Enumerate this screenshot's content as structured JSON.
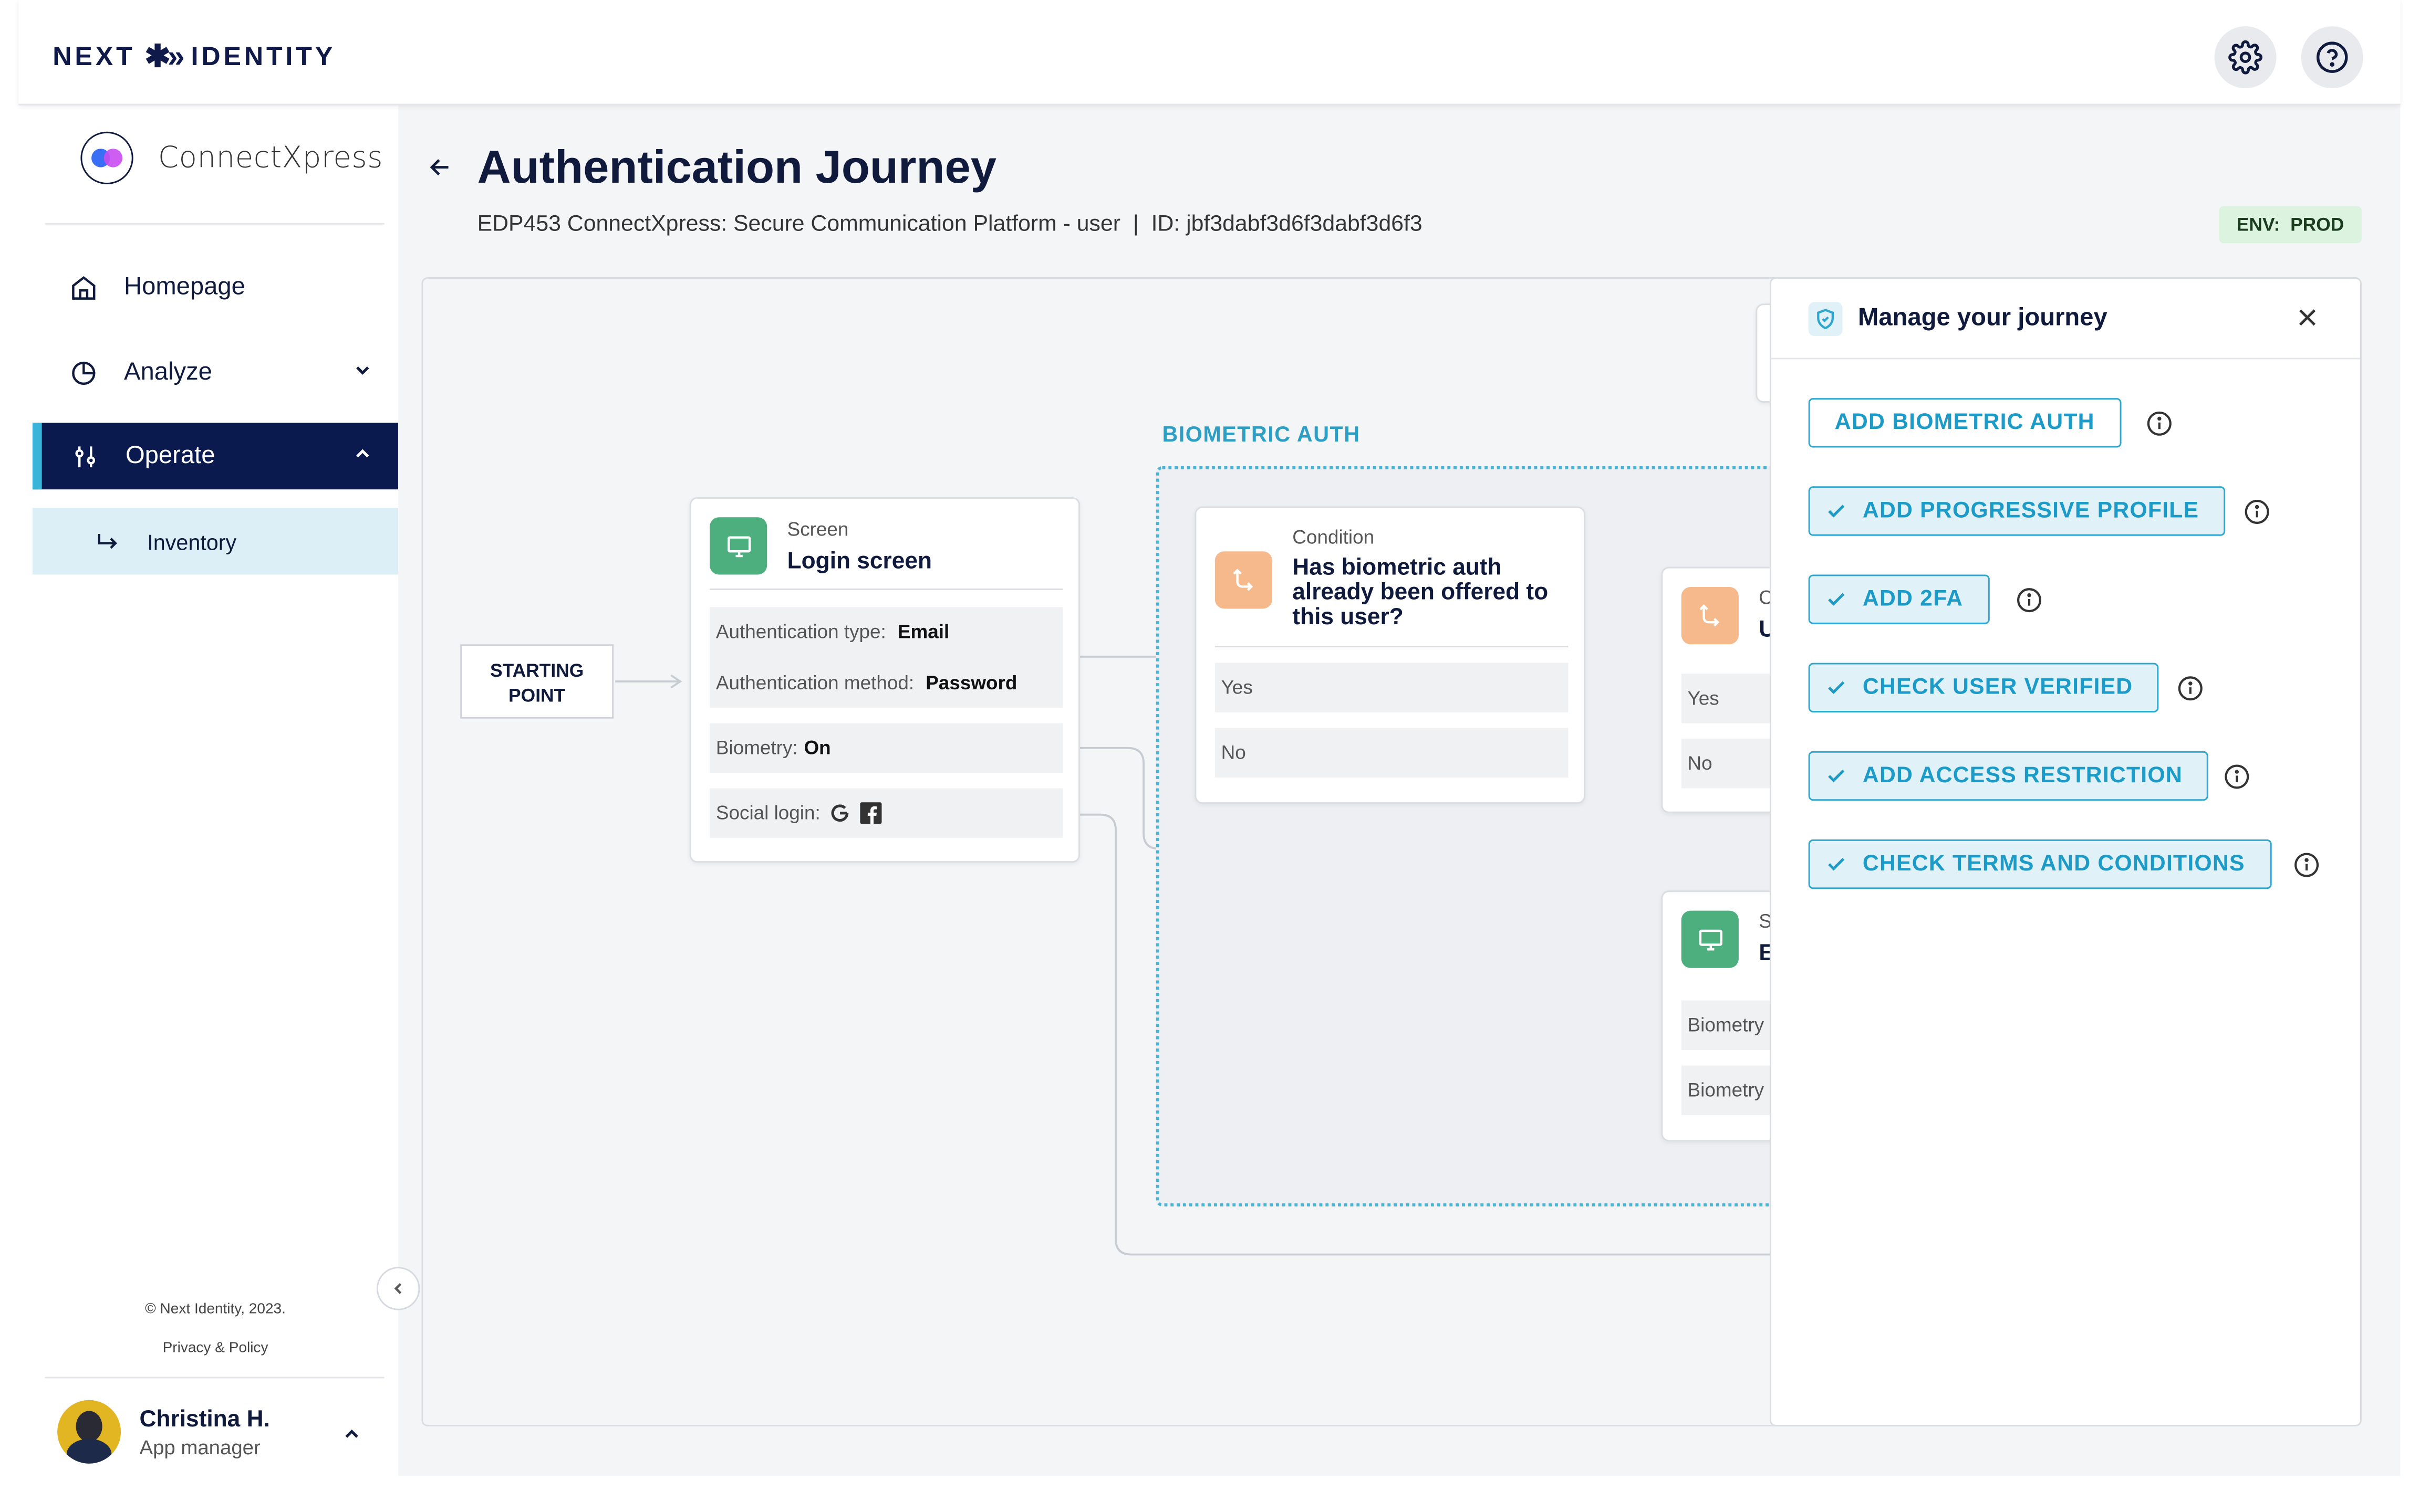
{
  "header": {
    "logo_left": "NEXT",
    "logo_mark": "✱»",
    "logo_right": "IDENTITY"
  },
  "sidebar": {
    "app_name": "ConnectXpress",
    "items": [
      {
        "label": "Homepage",
        "icon": "home-icon"
      },
      {
        "label": "Analyze",
        "icon": "pie-chart-icon"
      },
      {
        "label": "Operate",
        "icon": "sliders-icon"
      }
    ],
    "sub_item": {
      "label": "Inventory",
      "icon": "return-arrow-icon"
    },
    "copyright": "© Next Identity, 2023.",
    "privacy": "Privacy & Policy",
    "user": {
      "name": "Christina H.",
      "role": "App manager"
    }
  },
  "page": {
    "title": "Authentication Journey",
    "subtitle": "EDP453 ConnectXpress: Secure Communication Platform - user  |  ID: jbf3dabf3d6f3dabf3d6f3",
    "env_badge": "ENV:  PROD"
  },
  "canvas": {
    "start_label_1": "STARTING",
    "start_label_2": "POINT",
    "bio_zone_label": "BIOMETRIC AUTH",
    "login_card": {
      "kicker": "Screen",
      "title": "Login screen",
      "auth_type_label": "Authentication type:",
      "auth_type_value": "Email",
      "auth_method_label": "Authentication method:",
      "auth_method_value": "Password",
      "biometry_label": "Biometry:",
      "biometry_value": "On",
      "social_label": "Social login:"
    },
    "condition_card": {
      "kicker": "Condition",
      "title": "Has biometric auth already been offered to this user?",
      "yes": "Yes",
      "no": "No"
    },
    "partial_condition_card": {
      "kicker": "C",
      "title": "U",
      "yes": "Yes",
      "no": "No"
    },
    "partial_screen_card": {
      "kicker": "S",
      "title": "E",
      "row1": "Biometry",
      "row2": "Biometry"
    }
  },
  "panel": {
    "title": "Manage your journey",
    "options": [
      {
        "label": "ADD BIOMETRIC AUTH",
        "checked": false
      },
      {
        "label": "ADD PROGRESSIVE PROFILE",
        "checked": true
      },
      {
        "label": "ADD 2FA",
        "checked": true
      },
      {
        "label": "CHECK USER VERIFIED",
        "checked": true
      },
      {
        "label": "ADD ACCESS RESTRICTION",
        "checked": true
      },
      {
        "label": "CHECK TERMS AND CONDITIONS",
        "checked": true
      }
    ]
  },
  "colors": {
    "brand_navy": "#0a1a4f",
    "accent_teal": "#2fa6cf",
    "screen_green": "#4caf7d",
    "condition_orange": "#f5b98c",
    "env_green": "#dcf3df"
  }
}
